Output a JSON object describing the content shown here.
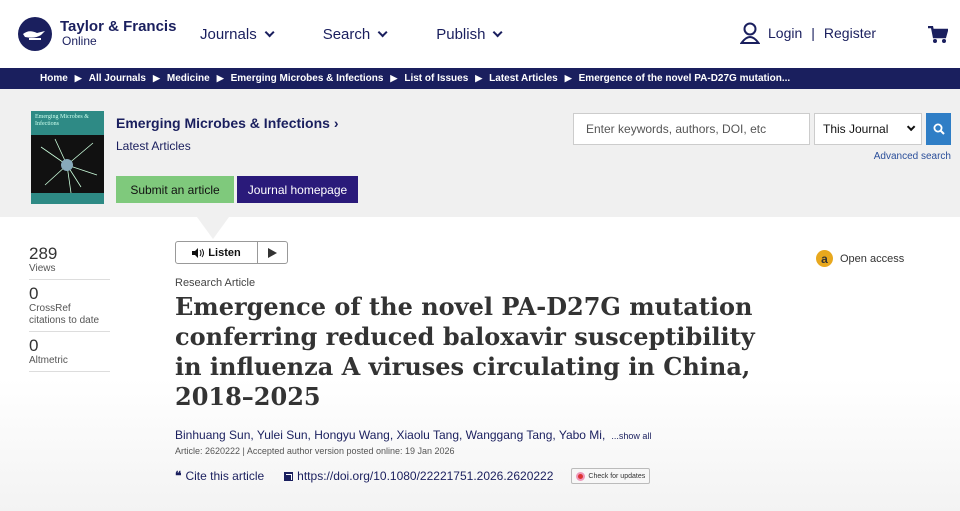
{
  "brand": {
    "name_line1": "Taylor & Francis",
    "name_line2": "Online"
  },
  "nav": {
    "journals": "Journals",
    "search": "Search",
    "publish": "Publish"
  },
  "account": {
    "login": "Login",
    "separator": "|",
    "register": "Register"
  },
  "breadcrumbs": [
    "Home",
    "All Journals",
    "Medicine",
    "Emerging Microbes & Infections",
    "List of Issues",
    "Latest Articles",
    "Emergence of the novel PA-D27G mutation..."
  ],
  "journal": {
    "cover_text": "Emerging Microbes & Infections",
    "title": "Emerging Microbes & Infections ›",
    "subtitle": "Latest Articles",
    "submit_label": "Submit an article",
    "homepage_label": "Journal homepage"
  },
  "search": {
    "placeholder": "Enter keywords, authors, DOI, etc",
    "scope": "This Journal",
    "advanced": "Advanced search"
  },
  "metrics": [
    {
      "value": "289",
      "label": "Views"
    },
    {
      "value": "0",
      "label": "CrossRef citations to date"
    },
    {
      "value": "0",
      "label": "Altmetric"
    }
  ],
  "article": {
    "listen_label": "Listen",
    "type": "Research Article",
    "title": "Emergence of the novel PA-D27G mutation conferring reduced baloxavir susceptibility in influenza A viruses circulating in China, 2018–2025",
    "authors": "Binhuang Sun, Yulei Sun, Hongyu Wang, Xiaolu Tang, Wanggang Tang, Yabo Mi,",
    "show_all": "...show all",
    "info": "Article: 2620222 | Accepted author version posted online: 19 Jan 2026",
    "cite_label": "Cite this article",
    "doi": "https://doi.org/10.1080/22221751.2026.2620222",
    "check_updates": "Check for updates",
    "open_access": "Open access"
  }
}
